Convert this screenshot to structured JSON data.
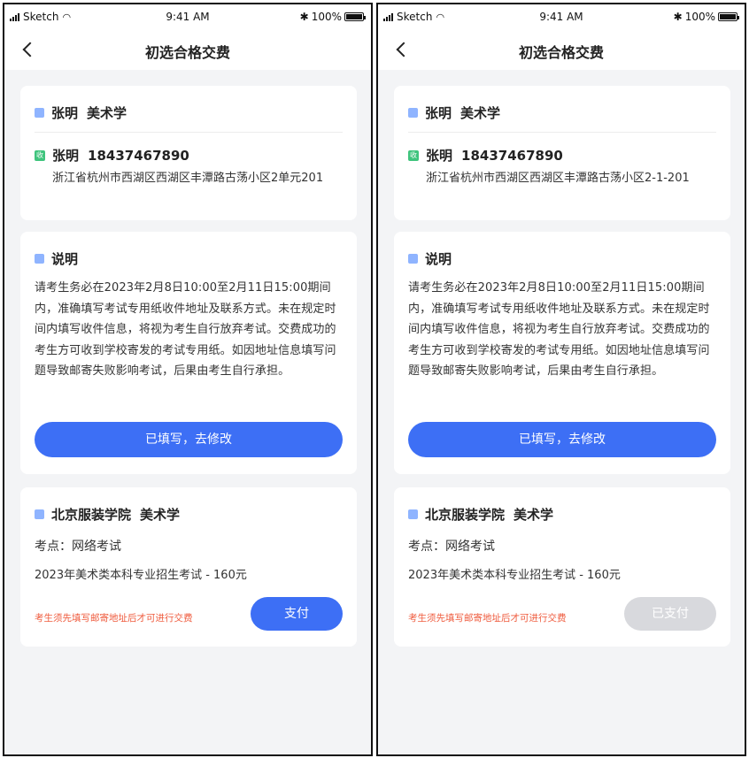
{
  "status_bar": {
    "carrier": "Sketch",
    "time": "9:41 AM",
    "battery": "100%"
  },
  "nav": {
    "title": "初选合格交费"
  },
  "screens": [
    {
      "address": {
        "applicant_name": "张明",
        "major": "美术学",
        "recipient_name": "张明",
        "phone": "18437467890",
        "address": "浙江省杭州市西湖区西湖区丰潭路古荡小区2单元201",
        "recipient_icon": "收"
      },
      "note": {
        "title": "说明",
        "body": "请考生务必在2023年2月8日10:00至2月11日15:00期间内，准确填写考试专用纸收件地址及联系方式。未在规定时间内填写收件信息，将视为考生自行放弃考试。交费成功的考生方可收到学校寄发的考试专用纸。如因地址信息填写问题导致邮寄失败影响考试，后果由考生自行承担。",
        "button": "已填写，去修改"
      },
      "payment": {
        "school": "北京服装学院",
        "major": "美术学",
        "exam_site": "考点：网络考试",
        "fee": "2023年美术类本科专业招生考试 - 160元",
        "warning": "考生须先填写邮寄地址后才可进行交费",
        "button": "支付"
      }
    },
    {
      "address": {
        "applicant_name": "张明",
        "major": "美术学",
        "recipient_name": "张明",
        "phone": "18437467890",
        "address": "浙江省杭州市西湖区西湖区丰潭路古荡小区2-1-201",
        "recipient_icon": "收"
      },
      "note": {
        "title": "说明",
        "body": "请考生务必在2023年2月8日10:00至2月11日15:00期间内，准确填写考试专用纸收件地址及联系方式。未在规定时间内填写收件信息，将视为考生自行放弃考试。交费成功的考生方可收到学校寄发的考试专用纸。如因地址信息填写问题导致邮寄失败影响考试，后果由考生自行承担。",
        "button": "已填写，去修改"
      },
      "payment": {
        "school": "北京服装学院",
        "major": "美术学",
        "exam_site": "考点：网络考试",
        "fee": "2023年美术类本科专业招生考试 - 160元",
        "warning": "考生须先填写邮寄地址后才可进行交费",
        "button": "已支付"
      }
    }
  ],
  "colors": {
    "accent": "#3d6ff5",
    "warning": "#ef5a3c",
    "disabled": "#d8d9dd",
    "receive_icon": "#3fc47d"
  }
}
